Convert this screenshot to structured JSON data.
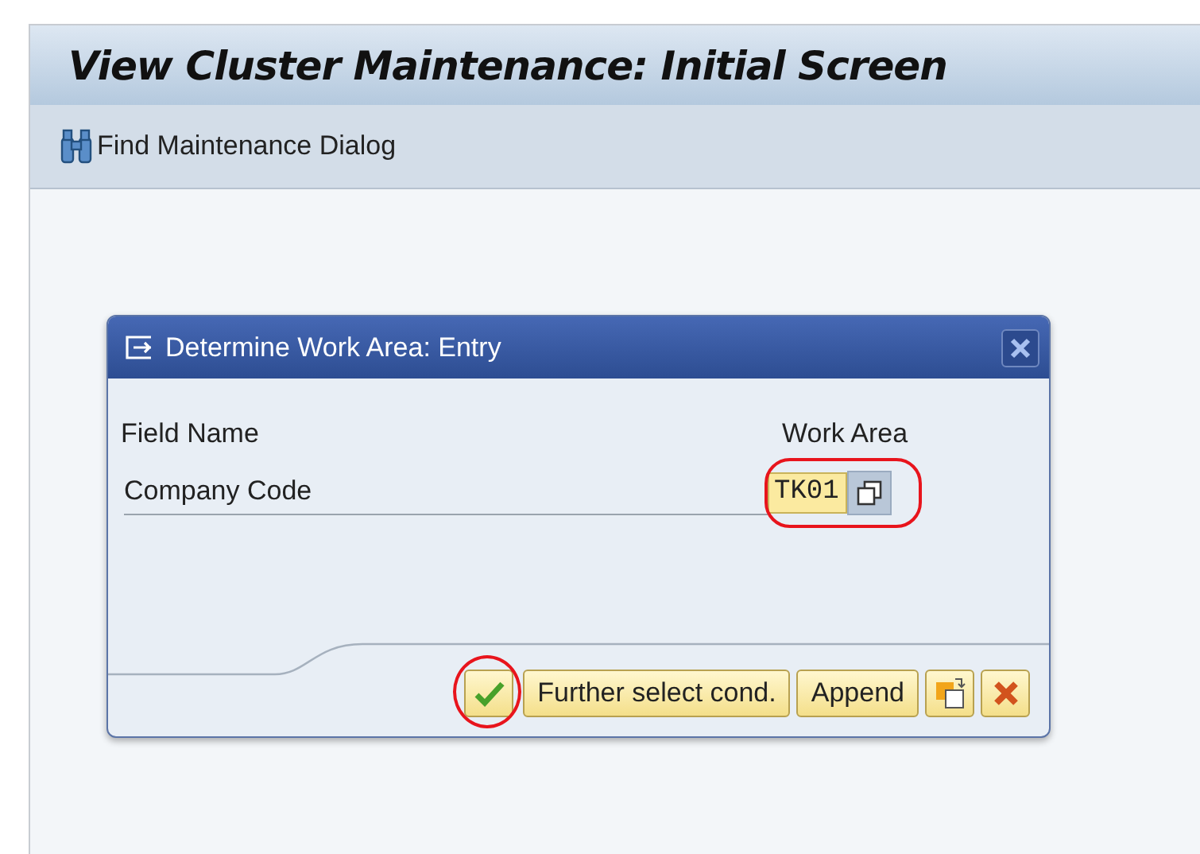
{
  "window": {
    "title": "View Cluster Maintenance: Initial Screen"
  },
  "toolbar": [
    {
      "label": "Find Maintenance Dialog"
    }
  ],
  "dialog": {
    "title": "Determine Work Area: Entry",
    "columns": [
      "Field Name",
      "Work Area"
    ],
    "rows": [
      {
        "field": "Company Code",
        "value": "TK01",
        "highlighted": true
      }
    ],
    "buttons": [
      {
        "kind": "check",
        "highlighted": true
      },
      {
        "kind": "text",
        "label": "Further select cond.",
        "highlighted": false
      },
      {
        "kind": "text",
        "label": "Append",
        "highlighted": false
      },
      {
        "kind": "copy",
        "highlighted": false
      },
      {
        "kind": "cancel",
        "highlighted": false
      }
    ]
  }
}
